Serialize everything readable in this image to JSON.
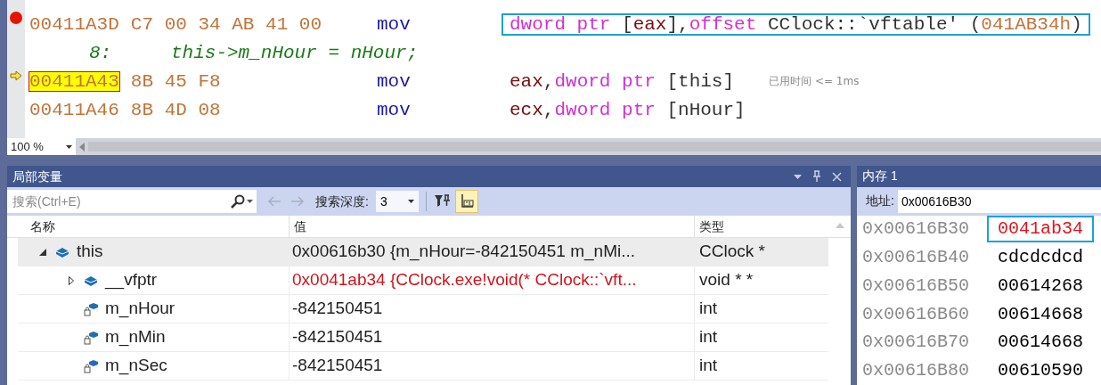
{
  "editor": {
    "lines": [
      {
        "kind": "asm",
        "breakpoint": true,
        "current": false,
        "highlighted": true,
        "address": "00411A3D",
        "bytes": "C7 00 34 AB 41 00",
        "mnemonic": "mov",
        "operands": [
          {
            "kind": "keyword",
            "text": "dword ptr"
          },
          {
            "kind": "plain",
            "text": " ["
          },
          {
            "kind": "register",
            "text": "eax"
          },
          {
            "kind": "plain",
            "text": "],"
          },
          {
            "kind": "keyword",
            "text": "offset"
          },
          {
            "kind": "plain",
            "text": " CClock::`vftable' ("
          },
          {
            "kind": "number",
            "text": "041AB34h"
          },
          {
            "kind": "plain",
            "text": ")"
          }
        ]
      },
      {
        "kind": "source",
        "line_no": "8:",
        "code": "this->m_nHour = nHour;"
      },
      {
        "kind": "asm",
        "breakpoint": false,
        "current": true,
        "highlighted": false,
        "address": "00411A43",
        "bytes": "8B 45 F8",
        "mnemonic": "mov",
        "operands": [
          {
            "kind": "register",
            "text": "eax"
          },
          {
            "kind": "plain",
            "text": ","
          },
          {
            "kind": "keyword",
            "text": "dword ptr"
          },
          {
            "kind": "plain",
            "text": " [this]"
          }
        ],
        "hint": "已用时间 <= 1ms"
      },
      {
        "kind": "asm",
        "breakpoint": false,
        "current": false,
        "highlighted": false,
        "address": "00411A46",
        "bytes": "8B 4D 08",
        "mnemonic": "mov",
        "operands": [
          {
            "kind": "register",
            "text": "ecx"
          },
          {
            "kind": "plain",
            "text": ","
          },
          {
            "kind": "keyword",
            "text": "dword ptr"
          },
          {
            "kind": "plain",
            "text": " [nHour]"
          }
        ]
      }
    ],
    "zoom": "100 %"
  },
  "locals": {
    "title": "局部变量",
    "search": {
      "placeholder": "搜索(Ctrl+E)"
    },
    "depth_label": "搜索深度:",
    "depth": "3",
    "toggle": {
      "on": true
    },
    "columns": [
      "名称",
      "值",
      "类型"
    ],
    "rows": [
      {
        "kind": "object",
        "name": "this",
        "value": "0x00616b30 {m_nHour=-842150451 m_nMi...",
        "type": "CClock *",
        "selected": true,
        "changed": false,
        "expanded": true,
        "children": [
          {
            "kind": "object",
            "name": "__vfptr",
            "value": "0x0041ab34 {CClock.exe!void(* CClock::`vft...",
            "type": "void * *",
            "selected": false,
            "changed": true,
            "expanded": false
          },
          {
            "kind": "field",
            "name": "m_nHour",
            "value": "-842150451",
            "type": "int",
            "selected": false,
            "changed": false
          },
          {
            "kind": "field",
            "name": "m_nMin",
            "value": "-842150451",
            "type": "int",
            "selected": false,
            "changed": false
          },
          {
            "kind": "field",
            "name": "m_nSec",
            "value": "-842150451",
            "type": "int",
            "selected": false,
            "changed": false
          }
        ]
      }
    ]
  },
  "memory": {
    "title": "内存 1",
    "address_label": "地址:",
    "address": "0x00616B30",
    "rows": [
      {
        "address": "0x00616B30",
        "value": "0041ab34",
        "changed": true,
        "selected": true
      },
      {
        "address": "0x00616B40",
        "value": "cdcdcdcd",
        "changed": false,
        "selected": false
      },
      {
        "address": "0x00616B50",
        "value": "00614268",
        "changed": false,
        "selected": false
      },
      {
        "address": "0x00616B60",
        "value": "00614668",
        "changed": false,
        "selected": false
      },
      {
        "address": "0x00616B70",
        "value": "00614668",
        "changed": false,
        "selected": false
      },
      {
        "address": "0x00616B80",
        "value": "00610590",
        "changed": false,
        "selected": false
      }
    ]
  }
}
